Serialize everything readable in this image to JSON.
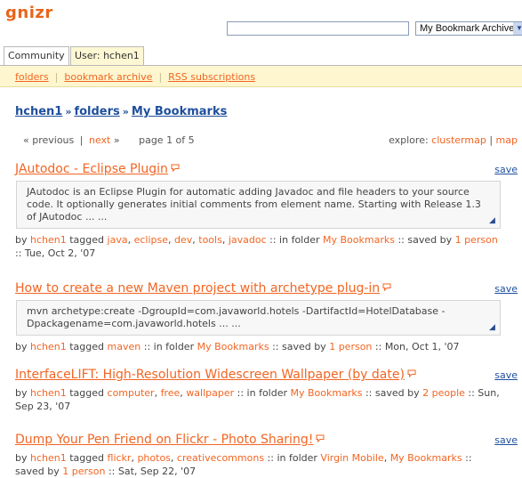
{
  "app": {
    "logo": "gnizr"
  },
  "search": {
    "value": "",
    "select_value": "My Bookmark Archive"
  },
  "tabs": [
    {
      "label": "Community"
    },
    {
      "label": "User: hchen1"
    }
  ],
  "subnav": [
    {
      "label": "folders"
    },
    {
      "label": "bookmark archive"
    },
    {
      "label": "RSS subscriptions"
    }
  ],
  "breadcrumb": {
    "user": "hchen1",
    "sep": "»",
    "folders": "folders",
    "current": "My Bookmarks"
  },
  "pager": {
    "prev_arrow": "«",
    "previous": "previous",
    "bar": "|",
    "next": "next",
    "next_arrow": "»",
    "page_info": "page 1 of 5"
  },
  "explore": {
    "label": "explore:",
    "clustermap": "clustermap",
    "bar": "|",
    "map": "map"
  },
  "save_label": "save",
  "colors": {
    "accent": "#f26522",
    "link_blue": "#1f4f9c",
    "subnav_bg": "#fdf6cf"
  },
  "posts": [
    {
      "title": "JAutodoc - Eclipse Plugin",
      "desc": "JAutodoc is an Eclipse Plugin for automatic adding Javadoc and file headers to your source code. It optionally generates initial comments from element name. Starting with Release 1.3 of JAutodoc ... ...",
      "by": "by",
      "user": "hchen1",
      "tagged": "tagged",
      "tags": [
        "java",
        "eclipse",
        "dev",
        "tools",
        "javadoc"
      ],
      "in_folder": ":: in folder",
      "folders": [
        "My Bookmarks"
      ],
      "saved_by": ":: saved by",
      "saved_count": "1 person",
      "date": ":: Tue, Oct 2, '07"
    },
    {
      "title": "How to create a new Maven project with archetype plug-in",
      "desc": "mvn archetype:create -DgroupId=com.javaworld.hotels -DartifactId=HotelDatabase -Dpackagename=com.javaworld.hotels ... ...",
      "by": "by",
      "user": "hchen1",
      "tagged": "tagged",
      "tags": [
        "maven"
      ],
      "in_folder": ":: in folder",
      "folders": [
        "My Bookmarks"
      ],
      "saved_by": ":: saved by",
      "saved_count": "1 person",
      "date": ":: Mon, Oct 1, '07"
    },
    {
      "title": "InterfaceLIFT: High-Resolution Widescreen Wallpaper (by date)",
      "desc": "",
      "by": "by",
      "user": "hchen1",
      "tagged": "tagged",
      "tags": [
        "computer",
        "free",
        "wallpaper"
      ],
      "in_folder": ":: in folder",
      "folders": [
        "My Bookmarks"
      ],
      "saved_by": ":: saved by",
      "saved_count": "2 people",
      "date": ":: Sun, Sep 23, '07"
    },
    {
      "title": "Dump Your Pen Friend on Flickr - Photo Sharing!",
      "desc": "",
      "by": "by",
      "user": "hchen1",
      "tagged": "tagged",
      "tags": [
        "flickr",
        "photos",
        "creativecommons"
      ],
      "in_folder": ":: in folder",
      "folders": [
        "Virgin Mobile",
        "My Bookmarks"
      ],
      "saved_by": ":: saved by",
      "saved_count": "1 person",
      "date": ":: Sat, Sep 22, '07"
    }
  ]
}
